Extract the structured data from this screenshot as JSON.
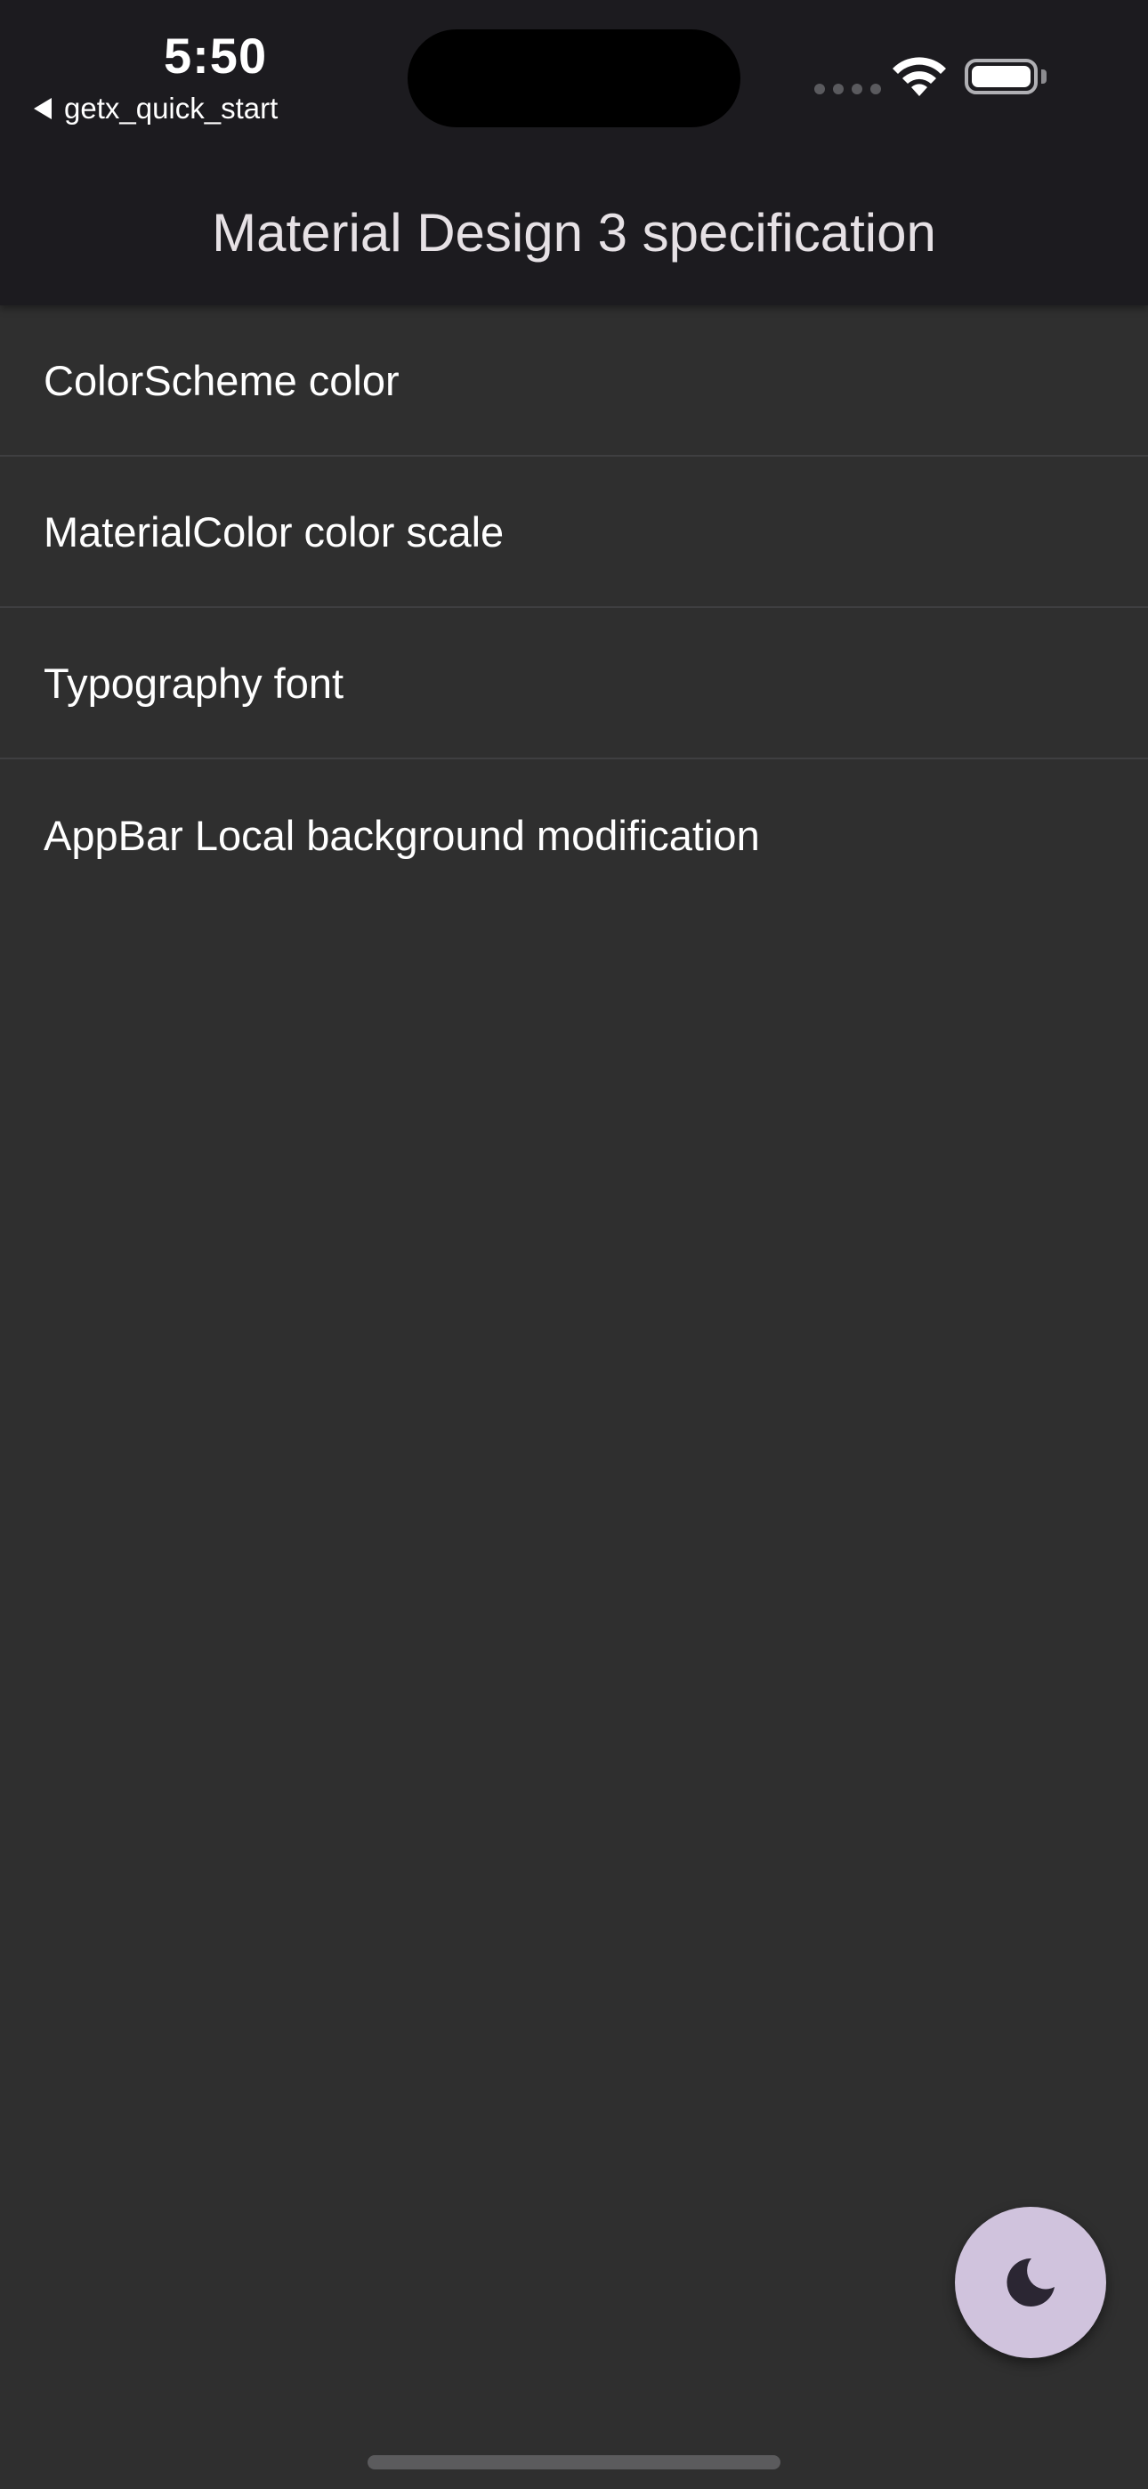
{
  "status_bar": {
    "time": "5:50",
    "back_app_label": "getx_quick_start",
    "icons": [
      "cellular-dots-icon",
      "wifi-icon",
      "battery-icon"
    ]
  },
  "app_bar": {
    "title": "Material Design 3 specification"
  },
  "list": {
    "items": [
      {
        "label": "ColorScheme color"
      },
      {
        "label": "MaterialColor color scale"
      },
      {
        "label": "Typography font"
      },
      {
        "label": "AppBar Local background modification"
      }
    ]
  },
  "fab": {
    "icon": "moon-icon"
  },
  "colors": {
    "background": "#2f2f2f",
    "app_bar": "#1c1b1f",
    "title_text": "#e6e1e5",
    "fab_background": "#d0c3dd",
    "fab_icon": "#2b2633",
    "divider": "#3f3f41"
  }
}
